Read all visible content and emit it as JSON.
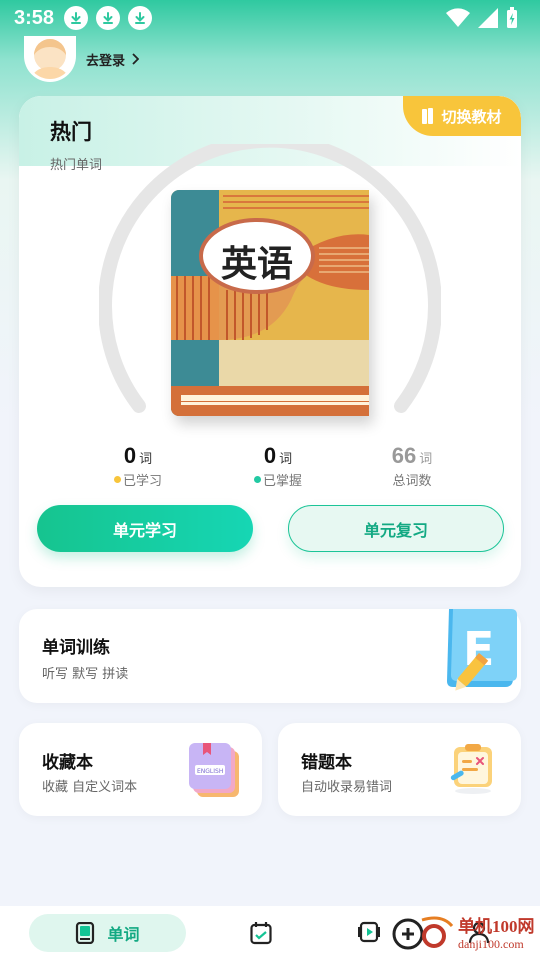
{
  "status_bar": {
    "time": "3:58",
    "icons": [
      "download-icon",
      "download-icon",
      "download-icon",
      "wifi-icon",
      "signal-icon",
      "battery-icon"
    ]
  },
  "header": {
    "login_label": "去登录"
  },
  "main_card": {
    "title": "热门",
    "subtitle": "热门单词",
    "switch_label": "切换教材",
    "book_title": "英语",
    "stats": [
      {
        "value": "0",
        "unit": "词",
        "label": "已学习",
        "dot_color": "#f8c53b"
      },
      {
        "value": "0",
        "unit": "词",
        "label": "已掌握",
        "dot_color": "#22c9a3"
      },
      {
        "value": "66",
        "unit": "词",
        "label": "总词数"
      }
    ],
    "learn_button": "单元学习",
    "review_button": "单元复习"
  },
  "training": {
    "title": "单词训练",
    "subtitle": "听写 默写 拼读",
    "icon": "letter-e-icon"
  },
  "favorites": {
    "title": "收藏本",
    "subtitle": "收藏 自定义词本",
    "icon": "notebook-icon",
    "icon_text": "ENGLISH"
  },
  "wrong_book": {
    "title": "错题本",
    "subtitle": "自动收录易错词",
    "icon": "clipboard-icon"
  },
  "bottom_nav": {
    "active_label": "单词",
    "items": [
      "book-icon",
      "calendar-icon",
      "video-icon",
      "profile-icon"
    ]
  },
  "watermark": {
    "text_top": "单机100网",
    "text_bottom": "danji100.com"
  },
  "colors": {
    "accent": "#16c48f",
    "brand_yellow": "#f8c53b",
    "background": "#f1f4fb"
  }
}
